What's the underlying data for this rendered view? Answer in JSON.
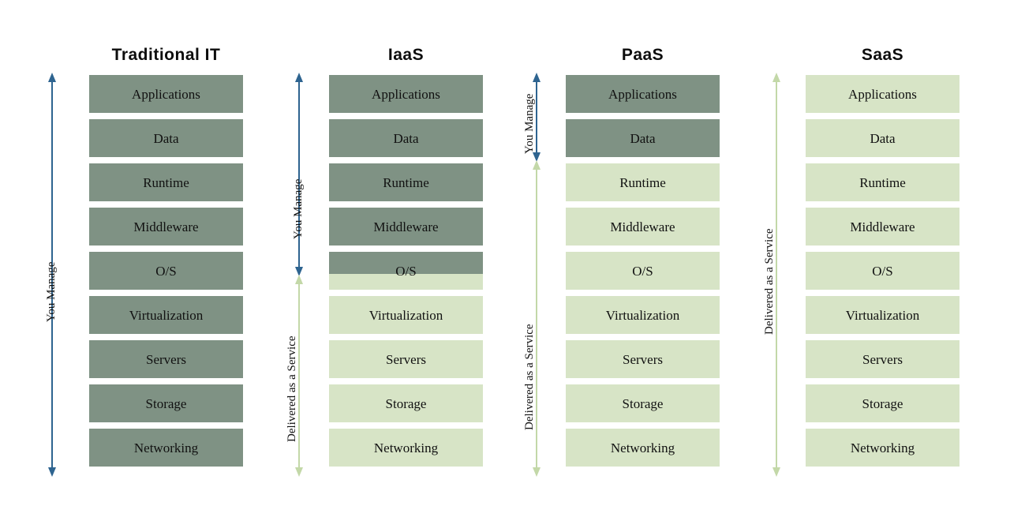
{
  "diagram": {
    "title_hidden": "",
    "layer_names": [
      "Applications",
      "Data",
      "Runtime",
      "Middleware",
      "O/S",
      "Virtualization",
      "Servers",
      "Storage",
      "Networking"
    ],
    "colors": {
      "managed_dark_green": "#7f9284",
      "service_light_green": "#d7e4c6",
      "you_manage_arrow_blue": "#2e6490",
      "delivered_arrow_green": "#c3d8a8",
      "text_black": "#111111",
      "background": "#ffffff"
    },
    "labels": {
      "you_manage": "You Manage",
      "delivered_as_a_service": "Delivered as a Service"
    },
    "columns": [
      {
        "id": "traditional-it",
        "title": "Traditional IT",
        "layers": [
          {
            "name": "Applications",
            "fill": "dark"
          },
          {
            "name": "Data",
            "fill": "dark"
          },
          {
            "name": "Runtime",
            "fill": "dark"
          },
          {
            "name": "Middleware",
            "fill": "dark"
          },
          {
            "name": "O/S",
            "fill": "dark"
          },
          {
            "name": "Virtualization",
            "fill": "dark"
          },
          {
            "name": "Servers",
            "fill": "dark"
          },
          {
            "name": "Storage",
            "fill": "dark"
          },
          {
            "name": "Networking",
            "fill": "dark"
          }
        ],
        "arrows": [
          {
            "type": "you-manage",
            "label": "You Manage",
            "color": "#2e6490",
            "heads": "both"
          }
        ]
      },
      {
        "id": "iaas",
        "title": "IaaS",
        "layers": [
          {
            "name": "Applications",
            "fill": "dark"
          },
          {
            "name": "Data",
            "fill": "dark"
          },
          {
            "name": "Runtime",
            "fill": "dark"
          },
          {
            "name": "Middleware",
            "fill": "dark"
          },
          {
            "name": "O/S",
            "fill": "split"
          },
          {
            "name": "Virtualization",
            "fill": "light"
          },
          {
            "name": "Servers",
            "fill": "light"
          },
          {
            "name": "Storage",
            "fill": "light"
          },
          {
            "name": "Networking",
            "fill": "light"
          }
        ],
        "arrows": [
          {
            "type": "you-manage",
            "label": "You Manage",
            "color": "#2e6490",
            "heads": "both"
          },
          {
            "type": "delivered",
            "label": "Delivered as a Service",
            "color": "#c3d8a8",
            "heads": "both"
          }
        ]
      },
      {
        "id": "paas",
        "title": "PaaS",
        "layers": [
          {
            "name": "Applications",
            "fill": "dark"
          },
          {
            "name": "Data",
            "fill": "dark"
          },
          {
            "name": "Runtime",
            "fill": "light"
          },
          {
            "name": "Middleware",
            "fill": "light"
          },
          {
            "name": "O/S",
            "fill": "light"
          },
          {
            "name": "Virtualization",
            "fill": "light"
          },
          {
            "name": "Servers",
            "fill": "light"
          },
          {
            "name": "Storage",
            "fill": "light"
          },
          {
            "name": "Networking",
            "fill": "light"
          }
        ],
        "arrows": [
          {
            "type": "you-manage",
            "label": "You Manage",
            "color": "#2e6490",
            "heads": "both"
          },
          {
            "type": "delivered",
            "label": "Delivered as a Service",
            "color": "#c3d8a8",
            "heads": "both"
          }
        ]
      },
      {
        "id": "saas",
        "title": "SaaS",
        "layers": [
          {
            "name": "Applications",
            "fill": "light"
          },
          {
            "name": "Data",
            "fill": "light"
          },
          {
            "name": "Runtime",
            "fill": "light"
          },
          {
            "name": "Middleware",
            "fill": "light"
          },
          {
            "name": "O/S",
            "fill": "light"
          },
          {
            "name": "Virtualization",
            "fill": "light"
          },
          {
            "name": "Servers",
            "fill": "light"
          },
          {
            "name": "Storage",
            "fill": "light"
          },
          {
            "name": "Networking",
            "fill": "light"
          }
        ],
        "arrows": [
          {
            "type": "delivered",
            "label": "Delivered as a Service",
            "color": "#c3d8a8",
            "heads": "both"
          }
        ]
      }
    ]
  }
}
